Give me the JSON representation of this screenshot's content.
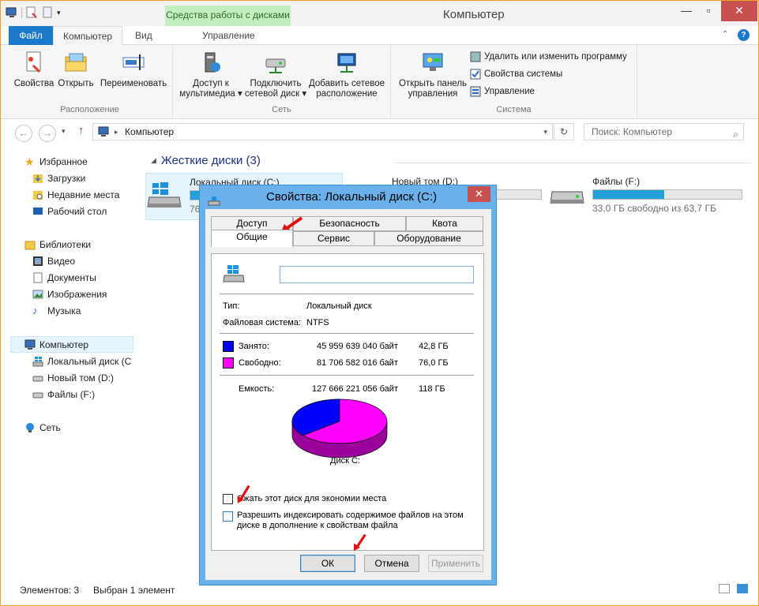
{
  "window": {
    "title": "Компьютер",
    "context_tab": "Средства работы с дисками"
  },
  "ribbon_tabs": {
    "file": "Файл",
    "computer": "Компьютер",
    "view": "Вид",
    "manage": "Управление"
  },
  "ribbon": {
    "groups": {
      "location": "Расположение",
      "network": "Сеть",
      "system": "Система"
    },
    "properties": "Свойства",
    "open": "Открыть",
    "rename": "Переименовать",
    "media_access_1": "Доступ к",
    "media_access_2": "мультимедиа",
    "map_drive_1": "Подключить",
    "map_drive_2": "сетевой диск",
    "add_location_1": "Добавить сетевое",
    "add_location_2": "расположение",
    "control_panel_1": "Открыть панель",
    "control_panel_2": "управления",
    "uninstall": "Удалить или изменить программу",
    "system_props": "Свойства системы",
    "manage": "Управление"
  },
  "address": {
    "path": "Компьютер",
    "search_placeholder": "Поиск: Компьютер"
  },
  "nav": {
    "favorites": "Избранное",
    "downloads": "Загрузки",
    "recent": "Недавние места",
    "desktop": "Рабочий стол",
    "libraries": "Библиотеки",
    "videos": "Видео",
    "documents": "Документы",
    "images": "Изображения",
    "music": "Музыка",
    "computer": "Компьютер",
    "local_c": "Локальный диск (C",
    "new_d": "Новый том (D:)",
    "files_f": "Файлы (F:)",
    "network": "Сеть"
  },
  "content": {
    "section": "Жесткие диски (3)",
    "drives": [
      {
        "name": "Локальный диск (C:)",
        "free": "76",
        "fill": 0.36
      },
      {
        "name": "Новый том (D:)",
        "free": "",
        "fill": 0.3
      },
      {
        "name": "Файлы (F:)",
        "free": "33,0 ГБ свободно из 63,7 ГБ",
        "fill": 0.48
      }
    ]
  },
  "status": {
    "items": "Элементов: 3",
    "selected": "Выбран 1 элемент"
  },
  "dialog": {
    "title": "Свойства: Локальный диск (C:)",
    "tabs": {
      "access": "Доступ",
      "security": "Безопасность",
      "quota": "Квота",
      "general": "Общие",
      "service": "Сервис",
      "hardware": "Оборудование"
    },
    "type_label": "Тип:",
    "type_value": "Локальный диск",
    "fs_label": "Файловая система:",
    "fs_value": "NTFS",
    "used_label": "Занято:",
    "used_bytes": "45 959 639 040 байт",
    "used_gb": "42,8 ГБ",
    "free_label": "Свободно:",
    "free_bytes": "81 706 582 016 байт",
    "free_gb": "76,0 ГБ",
    "capacity_label": "Емкость:",
    "capacity_bytes": "127 666 221 056 байт",
    "capacity_gb": "118 ГБ",
    "disk_label": "Диск C:",
    "compress": "Сжать этот диск для экономии места",
    "index_1": "Разрешить индексировать содержимое файлов на этом",
    "index_2": "диске в дополнение к свойствам файла",
    "ok": "ОК",
    "cancel": "Отмена",
    "apply": "Применить",
    "colors": {
      "used": "#0000ff",
      "free": "#ff00ff"
    }
  }
}
